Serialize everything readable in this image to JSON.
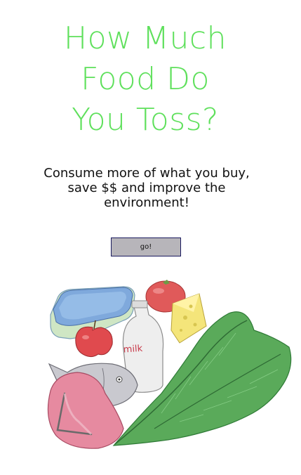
{
  "hero": {
    "title_lines": [
      "How Much",
      "Food Do",
      "You Toss?"
    ],
    "subtitle": "Consume more of what you buy, save $$ and improve the environment!"
  },
  "actions": {
    "go_label": "go!"
  },
  "illustration": {
    "milk_label": "milk",
    "items": [
      "container-icon",
      "apple-icon",
      "tomato-icon",
      "cheese-icon",
      "milk-bottle-icon",
      "fish-icon",
      "ham-icon",
      "lettuce-leaf-icon"
    ]
  },
  "colors": {
    "title": "#5fe05c",
    "button_bg": "#b7b5ba",
    "button_border": "#1a1a5e"
  }
}
